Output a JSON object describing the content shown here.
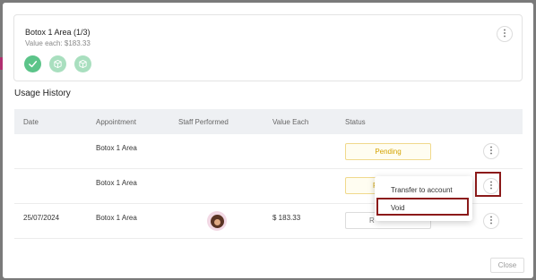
{
  "item_card": {
    "title": "Botox 1 Area (1/3)",
    "value_each": "Value each: $183.33",
    "progress_icons": [
      "check-icon",
      "cube-icon",
      "cube-icon"
    ]
  },
  "usage_history": {
    "title": "Usage History",
    "columns": [
      "Date",
      "Appointment",
      "Staff Performed",
      "Value Each",
      "Status"
    ],
    "rows": [
      {
        "date": "",
        "appointment": "Botox 1 Area",
        "staff": "",
        "value": "",
        "status": "Pending"
      },
      {
        "date": "",
        "appointment": "Botox 1 Area",
        "staff": "",
        "value": "",
        "status": "R"
      },
      {
        "date": "25/07/2024",
        "appointment": "Botox 1 Area",
        "staff": "avatar",
        "value": "$ 183.33",
        "status": "R"
      }
    ]
  },
  "context_menu": {
    "items": [
      "Transfer to account",
      "Void"
    ]
  },
  "footer": {
    "close_label": "Close"
  },
  "colors": {
    "accent_green": "#5cc489",
    "light_green": "#a9dfbf",
    "pending": "#d4a300",
    "highlight": "#8b1a1a"
  }
}
